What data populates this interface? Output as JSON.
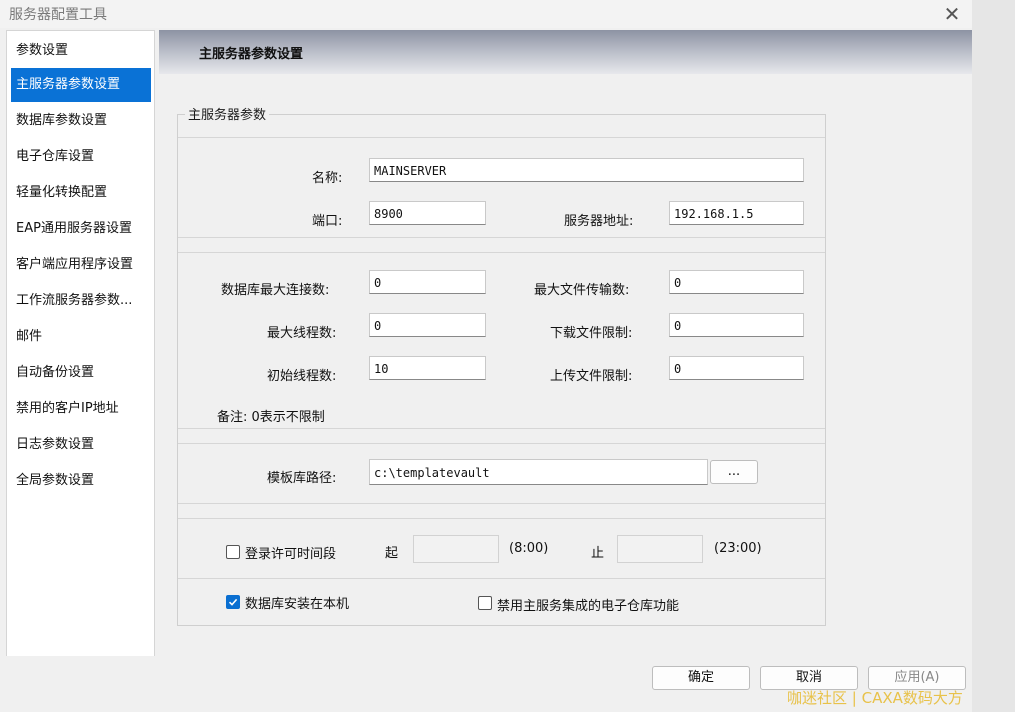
{
  "window": {
    "title": "服务器配置工具",
    "close_glyph": "✕"
  },
  "sidebar": {
    "items": [
      {
        "label": "参数设置",
        "active": false
      },
      {
        "label": "主服务器参数设置",
        "active": true
      },
      {
        "label": "数据库参数设置",
        "active": false
      },
      {
        "label": "电子仓库设置",
        "active": false
      },
      {
        "label": "轻量化转换配置",
        "active": false
      },
      {
        "label": "EAP通用服务器设置",
        "active": false
      },
      {
        "label": "客户端应用程序设置",
        "active": false
      },
      {
        "label": "工作流服务器参数...",
        "active": false
      },
      {
        "label": "邮件",
        "active": false
      },
      {
        "label": "自动备份设置",
        "active": false
      },
      {
        "label": "禁用的客户IP地址",
        "active": false
      },
      {
        "label": "日志参数设置",
        "active": false
      },
      {
        "label": "全局参数设置",
        "active": false
      }
    ]
  },
  "main": {
    "header_title": "主服务器参数设置",
    "group_title": "主服务器参数",
    "name": {
      "label": "名称:",
      "value": "MAINSERVER"
    },
    "port": {
      "label": "端口:",
      "value": "8900"
    },
    "server_address": {
      "label": "服务器地址:",
      "value": "192.168.1.5"
    },
    "db_max_connections": {
      "label": "数据库最大连接数:",
      "value": "0"
    },
    "max_file_transfers": {
      "label": "最大文件传输数:",
      "value": "0"
    },
    "max_threads": {
      "label": "最大线程数:",
      "value": "0"
    },
    "download_limit": {
      "label": "下载文件限制:",
      "value": "0"
    },
    "initial_threads": {
      "label": "初始线程数:",
      "value": "10"
    },
    "upload_limit": {
      "label": "上传文件限制:",
      "value": "0"
    },
    "note": "备注: 0表示不限制",
    "template_path": {
      "label": "模板库路径:",
      "value": "c:\\templatevault",
      "browse_label": "..."
    },
    "login_time": {
      "checkbox_label": "登录许可时间段",
      "checked": false,
      "start_label": "起",
      "start_value": "",
      "start_hint": "(8:00)",
      "end_label": "止",
      "end_value": "",
      "end_hint": "(23:00)"
    },
    "db_local": {
      "label": "数据库安装在本机",
      "checked": true
    },
    "disable_vault": {
      "label": "禁用主服务集成的电子仓库功能",
      "checked": false
    }
  },
  "footer": {
    "ok": "确定",
    "cancel": "取消",
    "apply": "应用(A)"
  },
  "watermark": "咖迷社区 | CAXA数码大方",
  "colors": {
    "accent": "#0a72d6",
    "watermark": "#e8c24a"
  }
}
